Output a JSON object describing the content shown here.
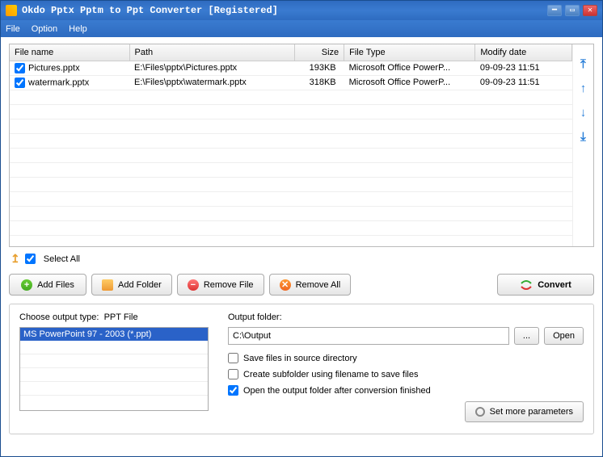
{
  "window": {
    "title": "Okdo Pptx Pptm to Ppt Converter [Registered]"
  },
  "menu": {
    "file": "File",
    "option": "Option",
    "help": "Help"
  },
  "table": {
    "headers": {
      "name": "File name",
      "path": "Path",
      "size": "Size",
      "type": "File Type",
      "date": "Modify date"
    },
    "rows": [
      {
        "checked": true,
        "name": "Pictures.pptx",
        "path": "E:\\Files\\pptx\\Pictures.pptx",
        "size": "193KB",
        "type": "Microsoft Office PowerP...",
        "date": "09-09-23 11:51"
      },
      {
        "checked": true,
        "name": "watermark.pptx",
        "path": "E:\\Files\\pptx\\watermark.pptx",
        "size": "318KB",
        "type": "Microsoft Office PowerP...",
        "date": "09-09-23 11:51"
      }
    ]
  },
  "selectall": {
    "label": "Select All",
    "checked": true
  },
  "buttons": {
    "addFiles": "Add Files",
    "addFolder": "Add Folder",
    "removeFile": "Remove File",
    "removeAll": "Remove All",
    "convert": "Convert"
  },
  "outputType": {
    "labelPrefix": "Choose output type:",
    "labelSuffix": "PPT File",
    "selected": "MS PowerPoint 97 - 2003 (*.ppt)"
  },
  "outputFolder": {
    "label": "Output folder:",
    "value": "C:\\Output",
    "browse": "...",
    "open": "Open"
  },
  "options": {
    "saveSource": {
      "label": "Save files in source directory",
      "checked": false
    },
    "subfolder": {
      "label": "Create subfolder using filename to save files",
      "checked": false
    },
    "openAfter": {
      "label": "Open the output folder after conversion finished",
      "checked": true
    }
  },
  "moreParams": "Set more parameters"
}
